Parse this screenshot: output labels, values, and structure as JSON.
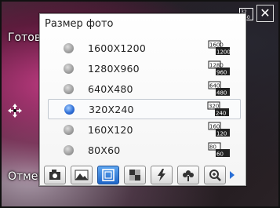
{
  "softkeys": {
    "done": "Готово",
    "cancel": "Отмена"
  },
  "top_bar": {
    "close_glyph": "✕"
  },
  "panel": {
    "title": "Размер фото",
    "options": [
      {
        "label": "1600X1200",
        "icon_top": "1600",
        "icon_bottom": "1200",
        "selected": false
      },
      {
        "label": "1280X960",
        "icon_top": "1280",
        "icon_bottom": "960",
        "selected": false
      },
      {
        "label": "640X480",
        "icon_top": "640",
        "icon_bottom": "480",
        "selected": false
      },
      {
        "label": "320X240",
        "icon_top": "320",
        "icon_bottom": "240",
        "selected": true
      },
      {
        "label": "160X120",
        "icon_top": "160",
        "icon_bottom": "120",
        "selected": false
      },
      {
        "label": "80X60",
        "icon_top": "80",
        "icon_bottom": "60",
        "selected": false
      }
    ]
  },
  "toolbar": {
    "buttons": [
      {
        "name": "camera-mode-icon",
        "active": false
      },
      {
        "name": "scene-landscape-icon",
        "active": false
      },
      {
        "name": "photo-size-icon",
        "active": true
      },
      {
        "name": "quality-grid-icon",
        "active": false
      },
      {
        "name": "flash-icon",
        "active": false
      },
      {
        "name": "macro-flower-icon",
        "active": false
      },
      {
        "name": "zoom-icon",
        "active": false
      }
    ],
    "more_arrow": "scroll-right-icon"
  },
  "colors": {
    "accent": "#1f66c8",
    "panel_bg": "#ffffff",
    "text": "#222222"
  }
}
